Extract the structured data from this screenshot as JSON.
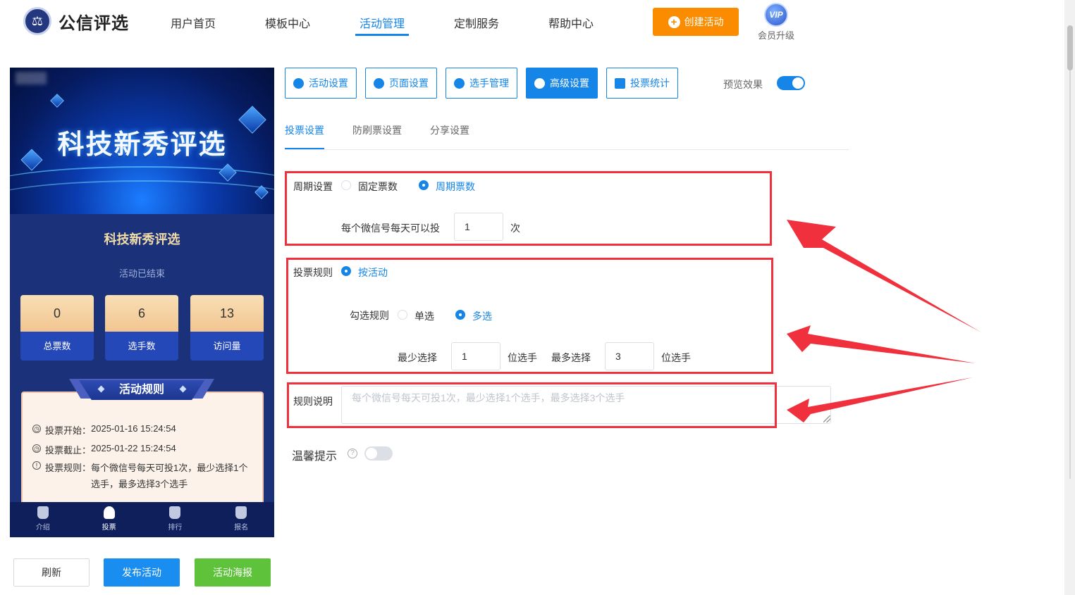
{
  "header": {
    "brand": "公信评选",
    "nav": [
      "用户首页",
      "模板中心",
      "活动管理",
      "定制服务",
      "帮助中心"
    ],
    "create_button": "创建活动",
    "vip_badge": "VIP",
    "vip_label": "会员升级"
  },
  "preview": {
    "banner_title": "科技新秀评选",
    "title": "科技新秀评选",
    "status": "活动已结束",
    "stats": [
      {
        "value": "0",
        "label": "总票数"
      },
      {
        "value": "6",
        "label": "选手数"
      },
      {
        "value": "13",
        "label": "访问量"
      }
    ],
    "rules_title": "活动规则",
    "rules": [
      {
        "label": "投票开始：",
        "value": "2025-01-16 15:24:54"
      },
      {
        "label": "投票截止：",
        "value": "2025-01-22 15:24:54"
      },
      {
        "label": "投票规则：",
        "value": "每个微信号每天可投1次，最少选择1个选手，最多选择3个选手"
      }
    ],
    "tabs": [
      "介绍",
      "投票",
      "排行",
      "报名"
    ]
  },
  "bottom_buttons": {
    "refresh": "刷新",
    "publish": "发布活动",
    "poster": "活动海报"
  },
  "settings": {
    "top_tabs": [
      "活动设置",
      "页面设置",
      "选手管理",
      "高级设置",
      "投票统计"
    ],
    "preview_label": "预览效果",
    "sub_tabs": [
      "投票设置",
      "防刷票设置",
      "分享设置"
    ],
    "cycle": {
      "label": "周期设置",
      "options": [
        "固定票数",
        "周期票数"
      ],
      "per_day_label": "每个微信号每天可以投",
      "per_day_value": "1",
      "per_day_unit": "次"
    },
    "rule": {
      "label": "投票规则",
      "option": "按活动",
      "check_label": "勾选规则",
      "check_options": [
        "单选",
        "多选"
      ],
      "min_label": "最少选择",
      "min_value": "1",
      "min_unit": "位选手",
      "max_label": "最多选择",
      "max_value": "3",
      "max_unit": "位选手"
    },
    "description": {
      "label": "规则说明",
      "placeholder": "每个微信号每天可投1次，最少选择1个选手，最多选择3个选手"
    },
    "warm_tip": {
      "label": "温馨提示",
      "help": "?"
    }
  },
  "colors": {
    "accent": "#1585e8",
    "orange": "#fb8c00",
    "green": "#5fc23b",
    "annotation_red": "#f0303c"
  }
}
